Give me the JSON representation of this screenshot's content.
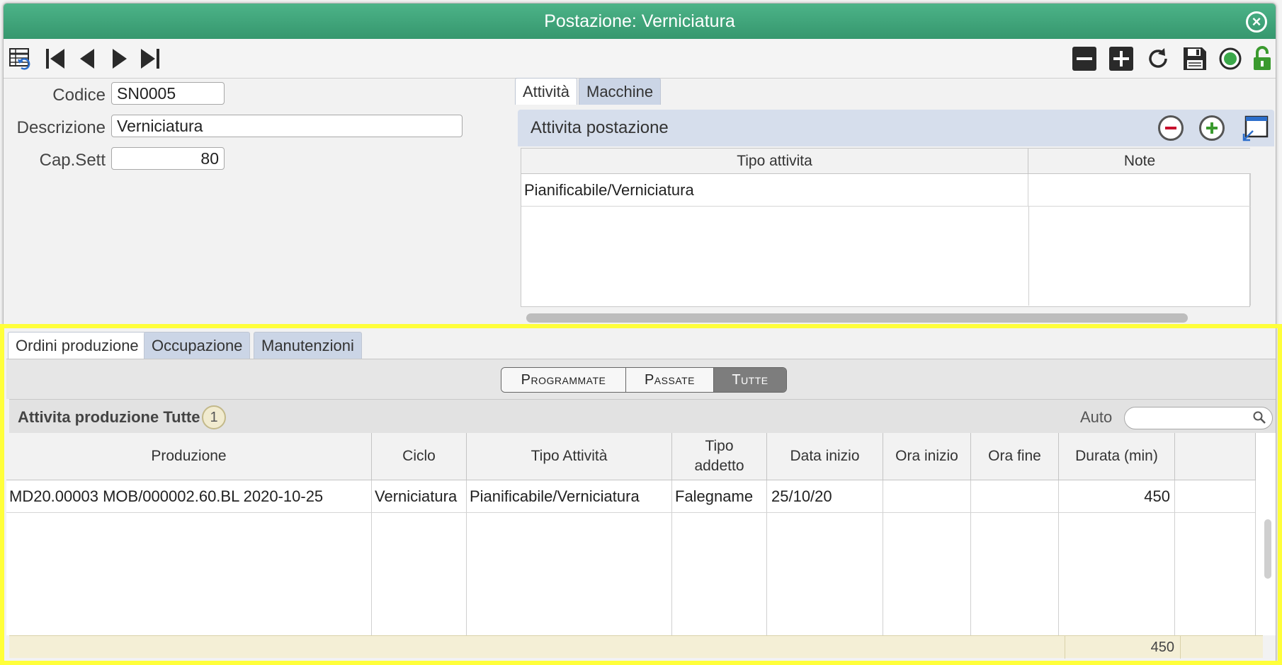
{
  "window": {
    "title": "Postazione: Verniciatura"
  },
  "form": {
    "codice_label": "Codice",
    "codice_value": "SN0005",
    "descrizione_label": "Descrizione",
    "descrizione_value": "Verniciatura",
    "capsett_label": "Cap.Sett",
    "capsett_value": "80"
  },
  "top_tabs": [
    {
      "label": "Attività",
      "active": true
    },
    {
      "label": "Macchine",
      "active": false
    }
  ],
  "activity_panel": {
    "title": "Attivita postazione",
    "columns": [
      "Tipo attivita",
      "Note"
    ],
    "rows": [
      [
        "Pianificabile/Verniciatura",
        ""
      ]
    ]
  },
  "bottom_tabs": [
    {
      "label": "Ordini produzione",
      "active": true
    },
    {
      "label": "Occupazione",
      "active": false
    },
    {
      "label": "Manutenzioni",
      "active": false
    }
  ],
  "filter": {
    "options": [
      "Programmate",
      "Passate",
      "Tutte"
    ],
    "selected": "Tutte"
  },
  "production": {
    "title": "Attivita produzione Tutte",
    "count": "1",
    "search_label": "Auto",
    "columns": [
      "Produzione",
      "Ciclo",
      "Tipo Attività",
      "Tipo addetto",
      "Data inizio",
      "Ora inizio",
      "Ora fine",
      "Durata (min)"
    ],
    "rows": [
      [
        "MD20.00003 MOB/000002.60.BL 2020-10-25",
        "Verniciatura",
        "Pianificabile/Verniciatura",
        "Falegname",
        "25/10/20",
        "",
        "",
        "450"
      ]
    ],
    "total_durata": "450"
  },
  "colors": {
    "titlebar": "#3fa67b",
    "tab_inactive": "#cbd5e6",
    "highlight": "#ffff3a",
    "footer": "#f4efd6"
  }
}
